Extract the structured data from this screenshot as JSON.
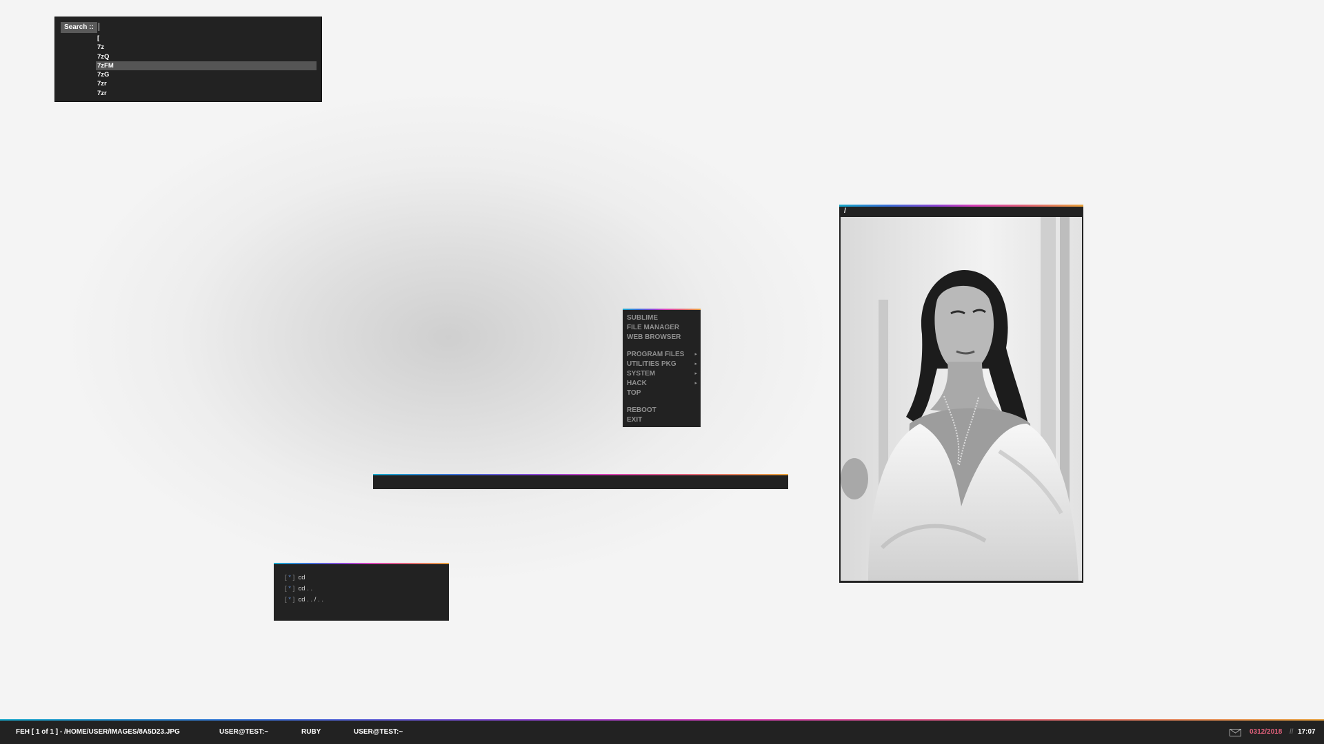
{
  "search": {
    "prompt": "Search ::",
    "items": [
      "[",
      "7z",
      "7zQ",
      "7zFM",
      "7zG",
      "7zr",
      "7zr"
    ],
    "selected_index": 3
  },
  "context_menu": {
    "items": [
      {
        "label": "SUBLIME",
        "submenu": false
      },
      {
        "label": "FILE MANAGER",
        "submenu": false
      },
      {
        "label": "WEB BROWSER",
        "submenu": false
      },
      {
        "label": "",
        "separator": true
      },
      {
        "label": "PROGRAM FILES",
        "submenu": true
      },
      {
        "label": "UTILITIES PKG",
        "submenu": true
      },
      {
        "label": "SYSTEM",
        "submenu": true
      },
      {
        "label": "HACK",
        "submenu": true
      },
      {
        "label": "TOP",
        "submenu": false
      },
      {
        "label": "",
        "separator": true
      },
      {
        "label": "REBOOT",
        "submenu": false
      },
      {
        "label": "EXIT",
        "submenu": false
      }
    ],
    "submenu_arrow": "▸"
  },
  "history": {
    "marker": "*",
    "rows": [
      "cd",
      "cd . .",
      "cd . . / . ."
    ]
  },
  "feh_window": {
    "title": "/",
    "image_description_icon": "photo-portrait"
  },
  "statusbar": {
    "feh_label": "FEH  [ 1 of 1 ]  -  /HOME/USER/IMAGES/8A5D23.JPG",
    "task1": "USER@TEST:~",
    "task2": "RUBY",
    "task3": "USER@TEST:~",
    "date": "0312/2018",
    "separator": "//",
    "time": "17:07",
    "mail_icon": "envelope-icon"
  },
  "colors": {
    "panel_bg": "#222222",
    "date_color": "#e0607a",
    "accent_cyan": "#16a7c9",
    "accent_magenta": "#d63fb8",
    "accent_orange": "#e8a13a"
  }
}
